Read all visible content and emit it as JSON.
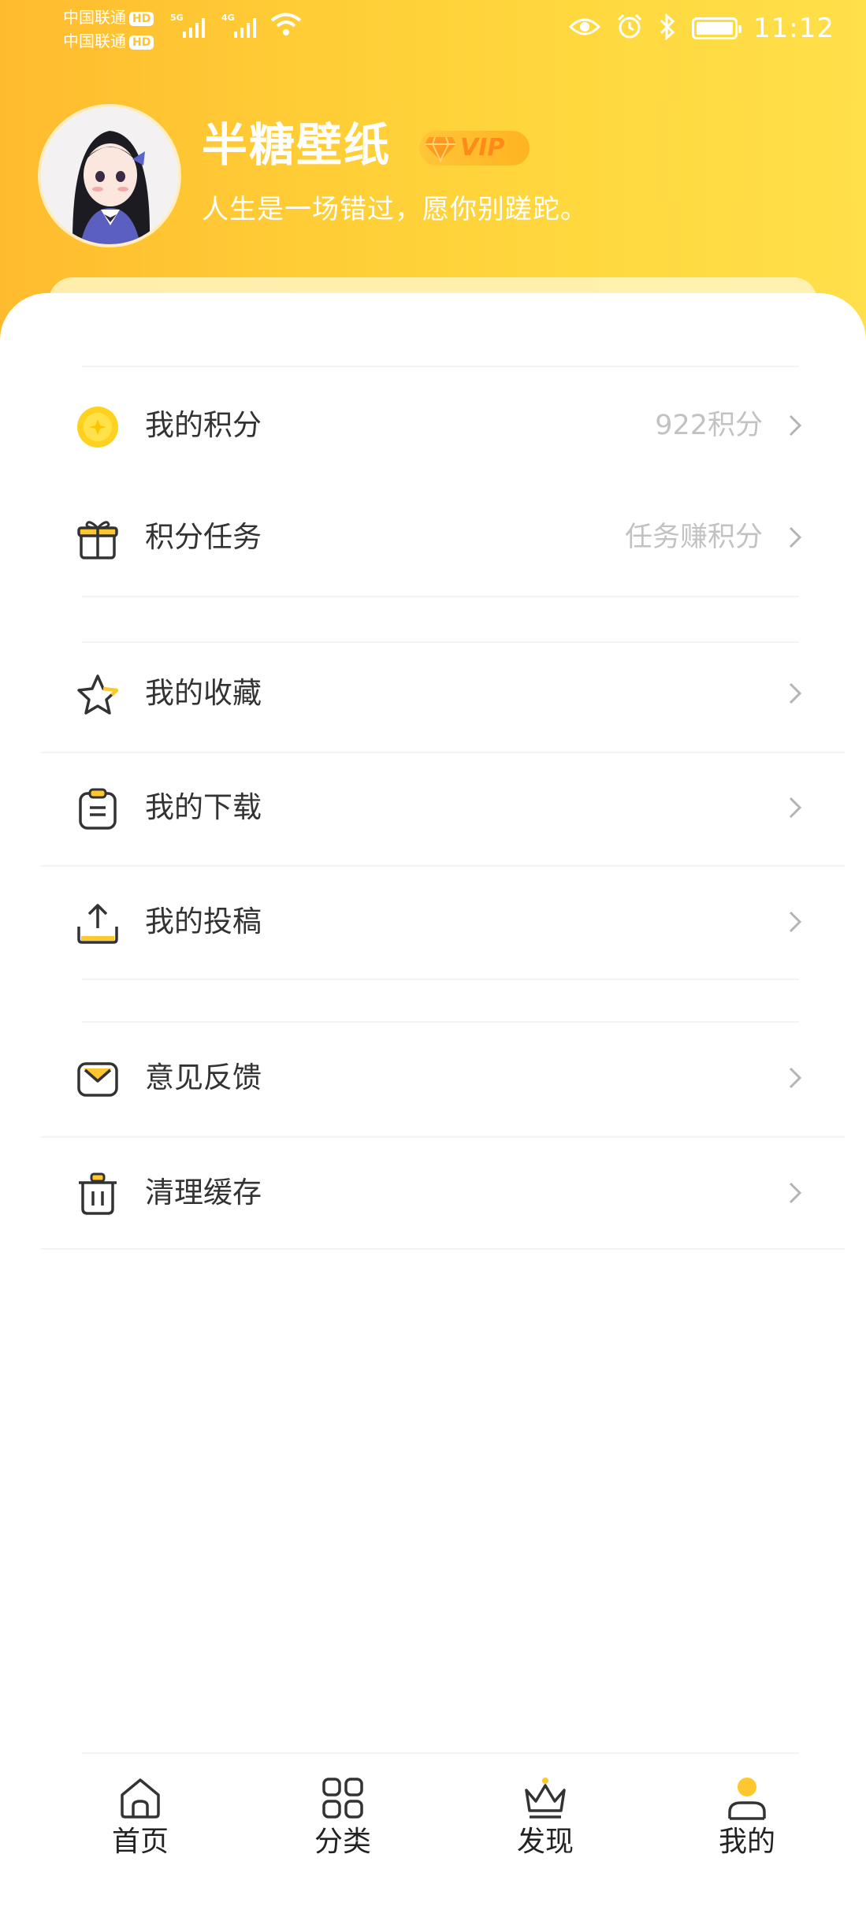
{
  "status_bar": {
    "carrier_1": "中国联通",
    "carrier_2": "中国联通",
    "hd_label": "HD",
    "sim1_network": "5G",
    "sim2_network": "4G",
    "time": "11:12",
    "battery_level": 1.0
  },
  "profile": {
    "username": "半糖壁纸",
    "vip_label": "VIP",
    "signature": "人生是一场错过，愿你别蹉跎。"
  },
  "menu": {
    "points": {
      "label": "我的积分",
      "value": "922积分",
      "icon": "coin-icon"
    },
    "tasks": {
      "label": "积分任务",
      "value": "任务赚积分",
      "icon": "gift-icon"
    },
    "favorites": {
      "label": "我的收藏",
      "icon": "star-icon"
    },
    "downloads": {
      "label": "我的下载",
      "icon": "clipboard-icon"
    },
    "uploads": {
      "label": "我的投稿",
      "icon": "upload-icon"
    },
    "feedback": {
      "label": "意见反馈",
      "icon": "mail-icon"
    },
    "clear_cache": {
      "label": "清理缓存",
      "icon": "trash-icon"
    }
  },
  "tabbar": {
    "home": "首页",
    "category": "分类",
    "discover": "发现",
    "mine": "我的",
    "active": "mine"
  },
  "colors": {
    "accent": "#ffc72e",
    "header_gradient_start": "#ffbb2e",
    "header_gradient_end": "#ffdf4a",
    "vip_text": "#ff8a1a",
    "muted_text": "#c2c2c2"
  }
}
